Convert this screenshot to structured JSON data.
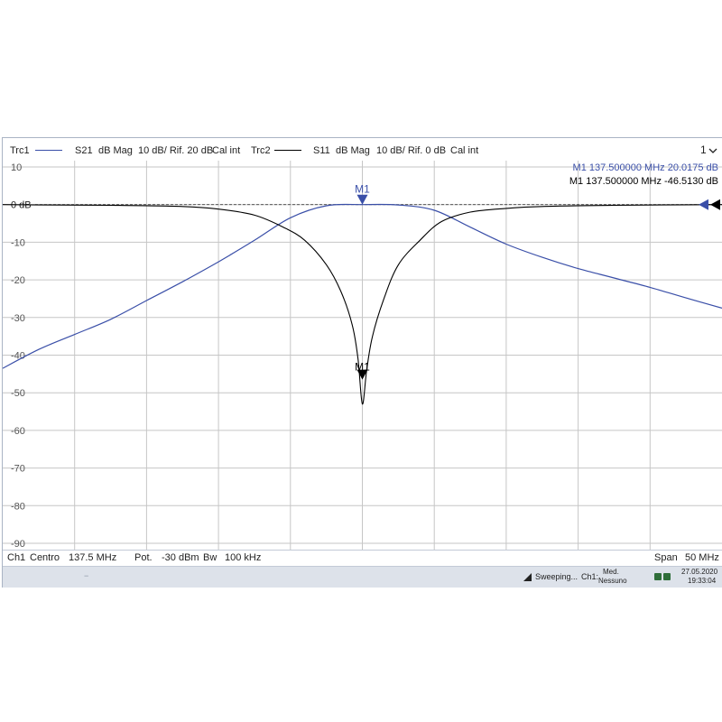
{
  "header": {
    "trc1": "Trc1",
    "trc1_param": "S21",
    "trc1_format": "dB Mag",
    "trc1_scale": "10 dB/ Rif. 20 dB",
    "trc1_cal": "Cal int",
    "trc2": "Trc2",
    "trc2_param": "S11",
    "trc2_format": "dB Mag",
    "trc2_scale": "10 dB/ Rif. 0 dB",
    "trc2_cal": "Cal int",
    "window": "1",
    "window_icon": "chevron-down-icon"
  },
  "markers": {
    "m1_trc1": "M1  137.500000  MHz  20.0175  dB",
    "m1_trc2": "M1  137.500000  MHz  -46.5130  dB",
    "label": "M1"
  },
  "footer": {
    "ch": "Ch1",
    "centro": "Centro",
    "center_value": "137.5 MHz",
    "pot": "Pot.",
    "pot_value": "-30 dBm",
    "bw": "Bw",
    "bw_value": "100 kHz",
    "span": "Span",
    "span_value": "50 MHz"
  },
  "status": {
    "sweeping": "Sweeping...",
    "ch": "Ch1:",
    "med": "Med.",
    "nessuno": "Nessuno",
    "date": "27.05.2020",
    "time": "19:33:04",
    "arrow": "−"
  },
  "colors": {
    "trc1": "#3a4fa8",
    "trc2": "#000000",
    "grid": "#c6c6c6",
    "axis_label": "#555555"
  },
  "chart_data": {
    "type": "line",
    "x_unit": "MHz",
    "xlim": [
      112.5,
      162.5
    ],
    "ylim": [
      -90,
      10
    ],
    "yticks": [
      "10",
      "0 dB",
      "-10",
      "-20",
      "-30",
      "-40",
      "-50",
      "-60",
      "-70",
      "-80",
      "-90"
    ],
    "reference_level": 0,
    "grid": true,
    "series": [
      {
        "name": "S21",
        "color": "#3a4fa8",
        "x": [
          112.5,
          115,
          117.5,
          120,
          122.5,
          125,
          127.5,
          130,
          132.5,
          135,
          137.5,
          140,
          142.5,
          145,
          147.5,
          150,
          152.5,
          155,
          157.5,
          160,
          162.5
        ],
        "y": [
          -43.5,
          -38.5,
          -34.5,
          -30.5,
          -25.5,
          -20.5,
          -15.2,
          -9.5,
          -3.5,
          -0.3,
          0,
          -0.1,
          -1.5,
          -6,
          -10.5,
          -14,
          -17,
          -19.5,
          -22,
          -24.8,
          -27.5
        ]
      },
      {
        "name": "S11",
        "color": "#000000",
        "x": [
          112.5,
          115,
          120,
          125,
          127.5,
          130,
          132,
          133.5,
          135,
          136,
          136.8,
          137.2,
          137.5,
          137.8,
          138.2,
          139,
          140,
          141.5,
          143,
          145,
          147.5,
          150,
          155,
          162.5
        ],
        "y": [
          0,
          -0.1,
          -0.2,
          -0.5,
          -1.2,
          -2.8,
          -6,
          -9.5,
          -16,
          -23,
          -32,
          -41,
          -53,
          -44,
          -35,
          -25,
          -16,
          -9.5,
          -4.5,
          -2,
          -1,
          -0.5,
          -0.2,
          0
        ]
      }
    ]
  }
}
